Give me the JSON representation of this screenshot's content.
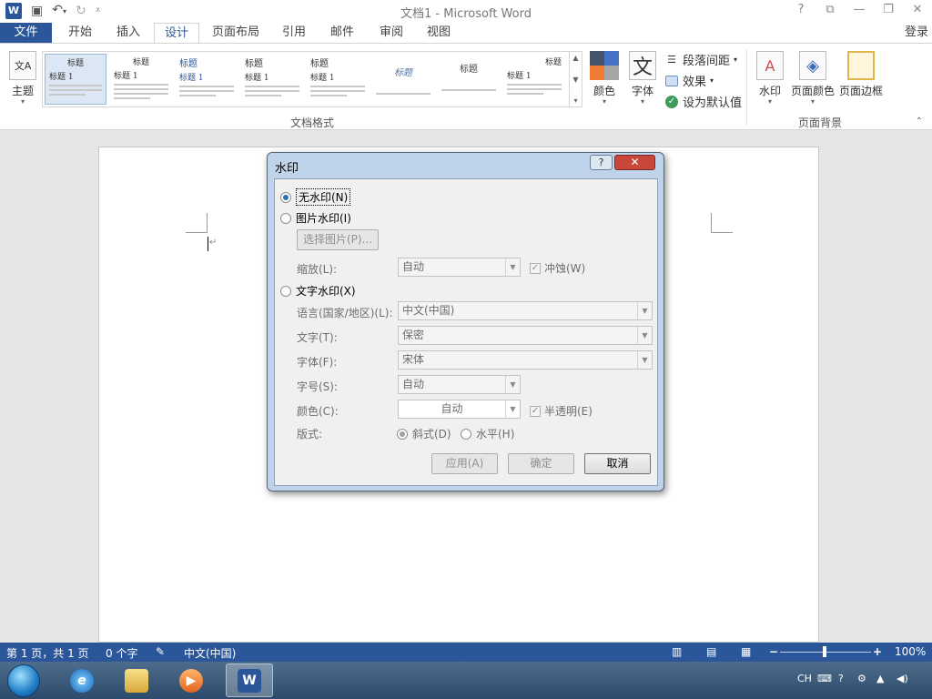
{
  "titlebar": {
    "app_icon": "W",
    "title": "文档1 - Microsoft Word",
    "controls": [
      "?",
      "⧉",
      "—",
      "❐",
      "✕"
    ]
  },
  "tabs": {
    "file": "文件",
    "home": "开始",
    "insert": "插入",
    "design": "设计",
    "layout": "页面布局",
    "references": "引用",
    "mailings": "邮件",
    "review": "审阅",
    "view": "视图",
    "signin": "登录"
  },
  "ribbon": {
    "theme_label": "主题",
    "theme_icon_text": "文A",
    "gallery_thumbs": [
      {
        "title": "标题",
        "heading": "标题 1"
      },
      {
        "title": "标题",
        "heading": "标题 1"
      },
      {
        "title": "标题",
        "heading": "标题 1"
      },
      {
        "title": "标题",
        "heading": "标题 1"
      },
      {
        "title": "标题",
        "heading": "标题 1"
      },
      {
        "title": "标题",
        "heading": ""
      },
      {
        "title": "标题",
        "heading": ""
      },
      {
        "title": "标题",
        "heading": "标题 1"
      }
    ],
    "doc_format_group": "文档格式",
    "colors_label": "颜色",
    "fonts_label": "字体",
    "fonts_icon_text": "文",
    "paragraph_spacing": "段落间距",
    "effects": "效果",
    "set_default": "设为默认值",
    "watermark_label": "水印",
    "page_color_label": "页面颜色",
    "page_border_label": "页面边框",
    "page_bg_group": "页面背景"
  },
  "dialog": {
    "title": "水印",
    "help": "?",
    "close": "✕",
    "no_watermark": "无水印(N)",
    "picture_watermark": "图片水印(I)",
    "select_picture": "选择图片(P)...",
    "scale_label": "缩放(L):",
    "scale_value": "自动",
    "washout": "冲蚀(W)",
    "text_watermark": "文字水印(X)",
    "language_label": "语言(国家/地区)(L):",
    "language_value": "中文(中国)",
    "text_label": "文字(T):",
    "text_value": "保密",
    "font_label": "字体(F):",
    "font_value": "宋体",
    "size_label": "字号(S):",
    "size_value": "自动",
    "color_label": "颜色(C):",
    "color_value": "自动",
    "semitransparent": "半透明(E)",
    "layout_label": "版式:",
    "diagonal": "斜式(D)",
    "horizontal": "水平(H)",
    "apply": "应用(A)",
    "ok": "确定",
    "cancel": "取消"
  },
  "statusbar": {
    "page": "第 1 页，共 1 页",
    "words": "0 个字",
    "language": "中文(中国)",
    "zoom": "100%"
  },
  "taskbar": {
    "lang": "CH",
    "word_label": "W"
  },
  "colors": {
    "accent": "#2b579a",
    "dialog_frame": "#bfd4ea",
    "close_red": "#c8473a"
  }
}
